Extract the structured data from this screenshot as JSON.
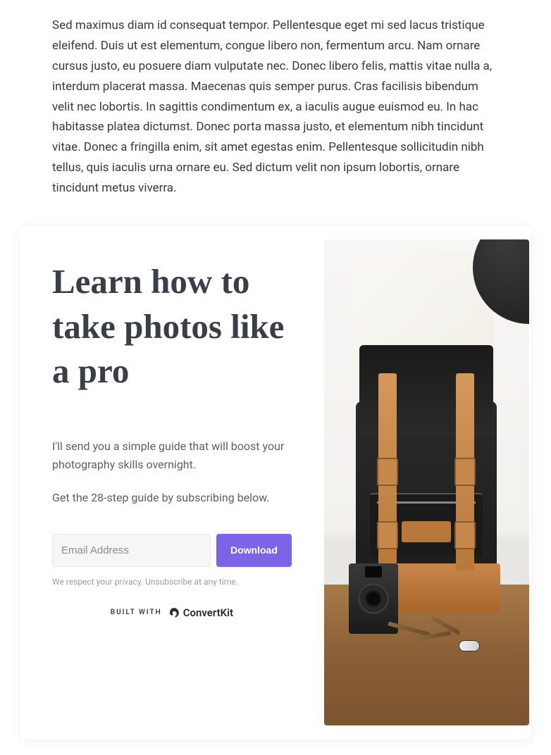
{
  "article": {
    "paragraph": "Sed maximus diam id consequat tempor. Pellentesque eget mi sed lacus tristique eleifend. Duis ut est elementum, congue libero non, fermentum arcu. Nam ornare cursus justo, eu posuere diam vulputate nec. Donec libero felis, mattis vitae nulla a, interdum placerat massa. Maecenas quis semper purus. Cras facilisis bibendum velit nec lobortis. In sagittis condimentum ex, a iaculis augue euismod eu. In hac habitasse platea dictumst. Donec porta massa justo, et elementum nibh tincidunt vitae. Donec a fringilla enim, sit amet egestas enim. Pellentesque sollicitudin nibh tellus, quis iaculis urna ornare eu. Sed dictum velit non ipsum lobortis, ornare tincidunt metus viverra."
  },
  "signup": {
    "heading": "Learn how to take photos like a pro",
    "para1": "I'll send you a simple guide that will boost your photography skills overnight.",
    "para2": "Get the 28-step guide by subscribing below.",
    "email_placeholder": "Email Address",
    "button_label": "Download",
    "privacy": "We respect your privacy. Unsubscribe at any time.",
    "built_with_label": "BUILT WITH",
    "brand": "ConvertKit"
  }
}
